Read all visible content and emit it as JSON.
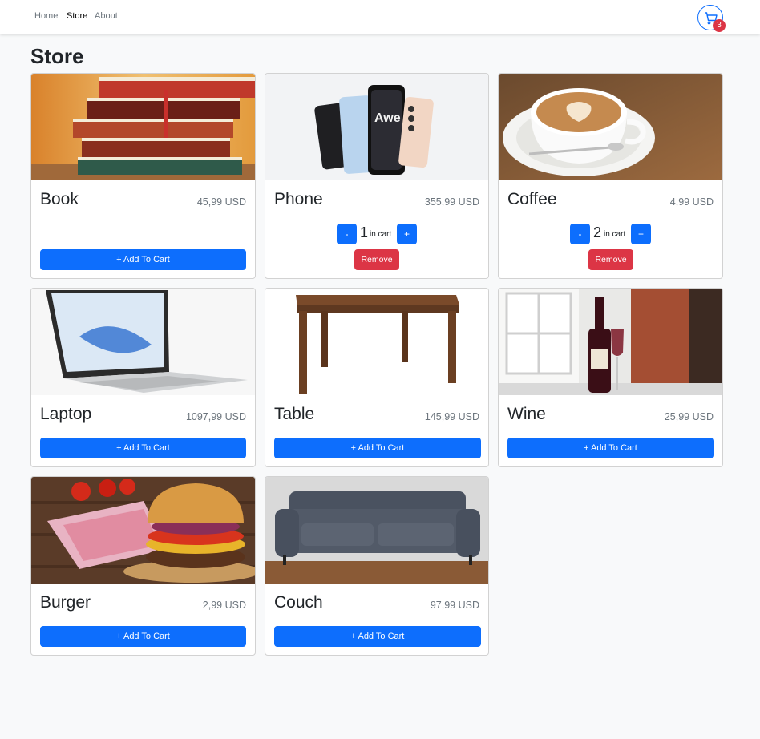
{
  "nav": {
    "links": [
      "Home",
      "Store",
      "About"
    ],
    "active": "Store",
    "cart_count": "3"
  },
  "page_title": "Store",
  "colors": {
    "primary": "#0d6efd",
    "danger": "#dc3545",
    "muted": "#6c757d",
    "background": "#f8f9fa"
  },
  "add_label": "+ Add To Cart",
  "remove_label": "Remove",
  "in_cart_label": "in cart",
  "minus_label": "-",
  "plus_label": "+",
  "products": [
    {
      "name": "Book",
      "price": "45,99 USD",
      "in_cart": null
    },
    {
      "name": "Phone",
      "price": "355,99 USD",
      "in_cart": "1"
    },
    {
      "name": "Coffee",
      "price": "4,99 USD",
      "in_cart": "2"
    },
    {
      "name": "Laptop",
      "price": "1097,99 USD",
      "in_cart": null
    },
    {
      "name": "Table",
      "price": "145,99 USD",
      "in_cart": null
    },
    {
      "name": "Wine",
      "price": "25,99 USD",
      "in_cart": null
    },
    {
      "name": "Burger",
      "price": "2,99 USD",
      "in_cart": null
    },
    {
      "name": "Couch",
      "price": "97,99 USD",
      "in_cart": null
    }
  ]
}
